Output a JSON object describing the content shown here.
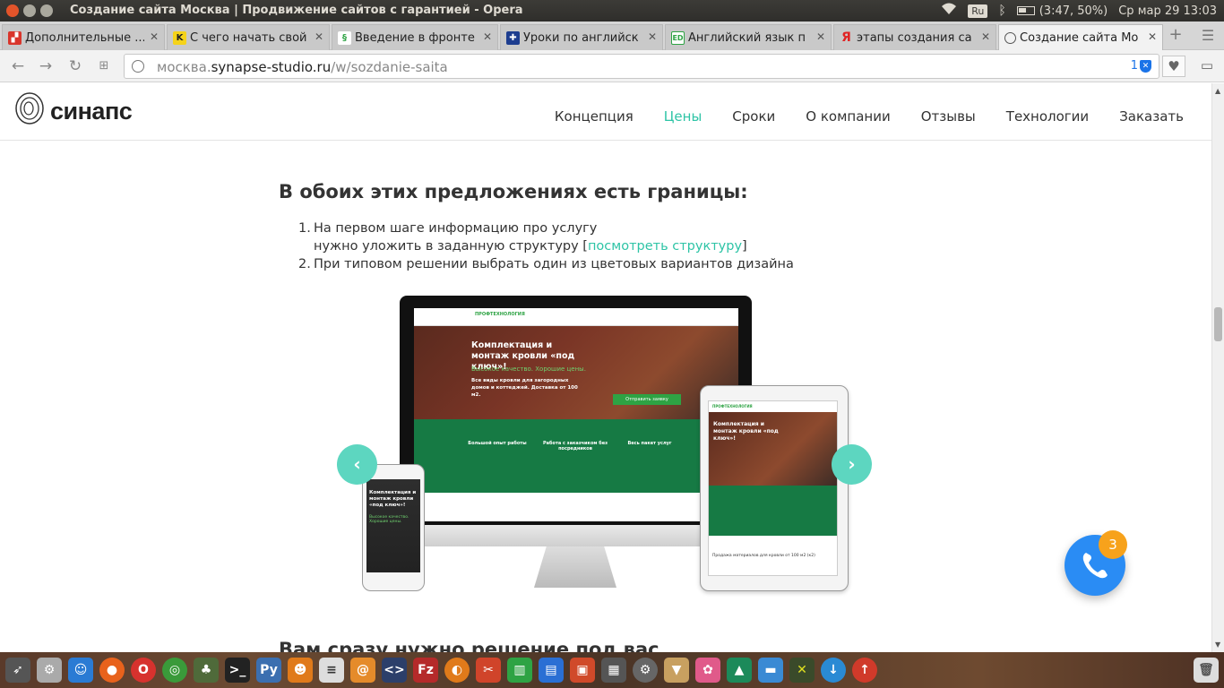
{
  "os_bar": {
    "window_title": "Создание сайта Москва | Продвижение сайтов с гарантией - Opera",
    "keyboard_layout": "Ru",
    "battery": "(3:47, 50%)",
    "datetime": "Ср мар 29 13:03"
  },
  "tabs": [
    {
      "title": "Дополнительные ...",
      "icon": "tab-favicon-red"
    },
    {
      "title": "С чего начать свой",
      "icon": "tab-favicon-yellow-k"
    },
    {
      "title": "Введение в фронте",
      "icon": "tab-favicon-green"
    },
    {
      "title": "Уроки по английск",
      "icon": "tab-favicon-uk-flag"
    },
    {
      "title": "Английский язык п",
      "icon": "tab-favicon-ed"
    },
    {
      "title": "этапы создания са",
      "icon": "tab-favicon-yandex"
    },
    {
      "title": "Создание сайта Мо",
      "icon": "tab-favicon-synapse"
    }
  ],
  "address": {
    "url_prefix": "москва.",
    "url_host": "synapse-studio.ru",
    "url_path": "/w/sozdanie-saita",
    "adblock_count": "1"
  },
  "site": {
    "logo_text": "синапс",
    "nav": [
      "Концепция",
      "Цены",
      "Сроки",
      "О компании",
      "Отзывы",
      "Технологии",
      "Заказать"
    ],
    "active_nav": "Цены"
  },
  "content": {
    "heading": "В обоих этих предложениях есть границы:",
    "step1_num": "1.",
    "step1_line1": "На первом шаге информацию про услугу",
    "step1_line2_prefix": "нужно уложить в заданную структуру [",
    "step1_link": "посмотреть структуру",
    "step1_line2_suffix": "]",
    "step2_num": "2.",
    "step2": "При типовом решении выбрать один из цветовых вариантов дизайна",
    "bottom_heading": "Вам сразу нужно решение под вас"
  },
  "mockup": {
    "hero_title": "Комплектация и монтаж кровли «под ключ»!",
    "hero_sub": "Высокое качество. Хорошие цены.",
    "hero_desc": "Все виды кровли для загородных домов и коттеджей. Доставка от 100 м2.",
    "hero_button": "Отправить заявку",
    "brand": "ПРОФТЕХНОЛОГИЯ",
    "feature1": "Большой опыт работы",
    "feature2": "Работа с заказчиком без посредников",
    "feature3": "Весь пакет услуг",
    "ipad_bottom": "Продажа материалов для кровли от 100 м2 (к2)"
  },
  "call_widget": {
    "badge": "3"
  },
  "colors": {
    "accent": "#2ec4a6",
    "call": "#2a8cf4",
    "badge": "#f7a21b",
    "carousel_arrow": "#5dd6c0"
  }
}
